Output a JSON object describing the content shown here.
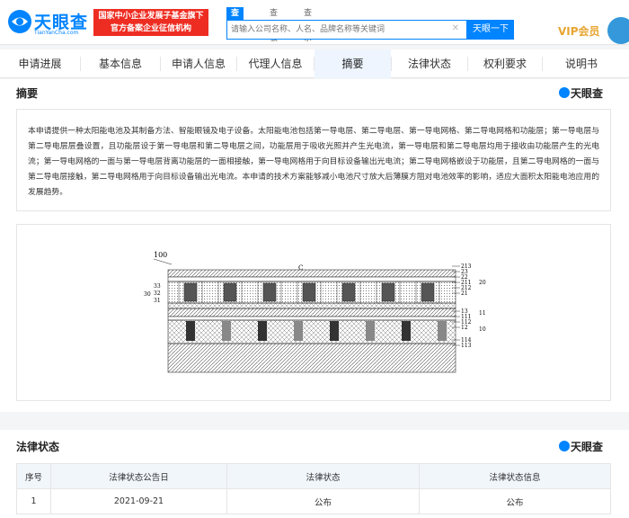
{
  "header": {
    "logo_text": "天眼查",
    "logo_sub": "TianYanCha.com",
    "banner_line1": "国家中小企业发展子基金旗下",
    "banner_line2": "官方备案企业征信机构",
    "search_tabs": [
      "查公司",
      "查老板",
      "查关系"
    ],
    "search_placeholder": "请输入公司名称、人名、品牌名称等关键词",
    "search_button": "天眼一下",
    "vip_label": "VIP会员"
  },
  "nav": {
    "items": [
      "申请进展",
      "基本信息",
      "申请人信息",
      "代理人信息",
      "摘要",
      "法律状态",
      "权利要求",
      "说明书"
    ],
    "active_index": 4
  },
  "abstract": {
    "title": "摘要",
    "brand": "天眼查",
    "text": "本申请提供一种太阳能电池及其制备方法、智能眼镜及电子设备。太阳能电池包括第一导电层、第二导电层、第一导电网格、第二导电网格和功能层；第一导电层与第二导电层层叠设置，且功能层设于第一导电层和第二导电层之间，功能层用于吸收光照并产生光电流，第一导电层和第二导电层均用于接收由功能层产生的光电流；第一导电网格的一面与第一导电层背离功能层的一面相接触，第一导电网格用于向目标设备输出光电流；第二导电网格嵌设于功能层，且第二导电网格的一面与第二导电层接触，第二导电网格用于向目标设备输出光电流。本申请的技术方案能够减小电池尺寸放大后薄膜方阻对电池效率的影响，适应大面积太阳能电池应用的发展趋势。"
  },
  "figure": {
    "label_main": "100",
    "label_c": "C",
    "left_labels": [
      "33",
      "32",
      "31"
    ],
    "left_group": "30",
    "right_labels": [
      "213",
      "23",
      "22",
      "211",
      "212",
      "21",
      "13",
      "111",
      "112",
      "12",
      "114",
      "113"
    ],
    "right_groups": [
      "20",
      "11",
      "10"
    ]
  },
  "legal": {
    "title": "法律状态",
    "brand": "天眼查",
    "columns": [
      "序号",
      "法律状态公告日",
      "法律状态",
      "法律状态信息"
    ],
    "rows": [
      [
        "1",
        "2021-09-21",
        "公布",
        "公布"
      ]
    ]
  },
  "colors": {
    "brand_blue": "#0084ff",
    "banner_red": "#ee2d22",
    "vip_gold": "#e8a531"
  }
}
